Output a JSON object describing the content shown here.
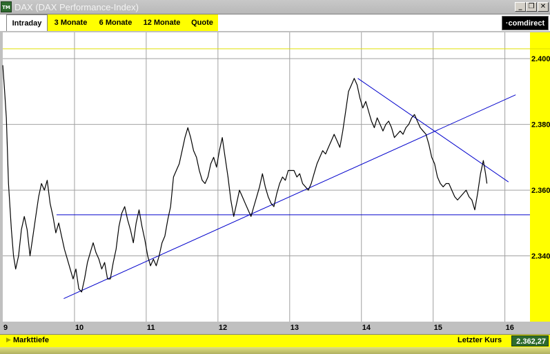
{
  "window": {
    "title": "DAX (DAX Performance-Index)",
    "icon_label": "TM",
    "controls": {
      "minimize": "_",
      "restore": "❐",
      "close": "✕"
    }
  },
  "tabs": [
    {
      "label": "Intraday",
      "active": true
    },
    {
      "label": "3 Monate",
      "active": false
    },
    {
      "label": "6 Monate",
      "active": false
    },
    {
      "label": "12 Monate",
      "active": false
    },
    {
      "label": "Quote",
      "active": false
    }
  ],
  "brand": "·comdirect",
  "colors": {
    "accent": "#ffff00",
    "price": "#000000",
    "trend": "#0000cc",
    "grid": "#a0a0a0",
    "value_bg": "#2e6b2e"
  },
  "status": {
    "left_label": "Markttiefe",
    "right_label": "Letzter Kurs",
    "value": "2.362,27"
  },
  "chart_data": {
    "type": "line",
    "title": "",
    "xlabel": "",
    "ylabel": "",
    "x_ticks": [
      "9",
      "10",
      "11",
      "12",
      "13",
      "14",
      "15",
      "16"
    ],
    "y_ticks": [
      "2.340",
      "2.360",
      "2.380",
      "2.400"
    ],
    "xlim": [
      9,
      16.35
    ],
    "ylim": [
      2320,
      2408
    ],
    "grid": true,
    "reference_line": {
      "y": 2403
    },
    "series": [
      {
        "values": [
          [
            9.0,
            2398
          ],
          [
            9.02,
            2392
          ],
          [
            9.05,
            2382
          ],
          [
            9.08,
            2362
          ],
          [
            9.12,
            2348
          ],
          [
            9.15,
            2340
          ],
          [
            9.18,
            2336
          ],
          [
            9.22,
            2340
          ],
          [
            9.26,
            2348
          ],
          [
            9.3,
            2352
          ],
          [
            9.34,
            2348
          ],
          [
            9.38,
            2340
          ],
          [
            9.42,
            2346
          ],
          [
            9.46,
            2352
          ],
          [
            9.5,
            2358
          ],
          [
            9.54,
            2362
          ],
          [
            9.58,
            2360
          ],
          [
            9.62,
            2363
          ],
          [
            9.66,
            2356
          ],
          [
            9.7,
            2352
          ],
          [
            9.74,
            2347
          ],
          [
            9.78,
            2350
          ],
          [
            9.82,
            2346
          ],
          [
            9.86,
            2342
          ],
          [
            9.9,
            2339
          ],
          [
            9.94,
            2336
          ],
          [
            9.98,
            2333
          ],
          [
            10.02,
            2336
          ],
          [
            10.06,
            2330
          ],
          [
            10.1,
            2329
          ],
          [
            10.14,
            2333
          ],
          [
            10.18,
            2338
          ],
          [
            10.22,
            2341
          ],
          [
            10.26,
            2344
          ],
          [
            10.3,
            2341
          ],
          [
            10.34,
            2339
          ],
          [
            10.38,
            2336
          ],
          [
            10.42,
            2338
          ],
          [
            10.46,
            2333
          ],
          [
            10.5,
            2333
          ],
          [
            10.54,
            2338
          ],
          [
            10.58,
            2342
          ],
          [
            10.62,
            2349
          ],
          [
            10.66,
            2353
          ],
          [
            10.7,
            2355
          ],
          [
            10.74,
            2351
          ],
          [
            10.78,
            2348
          ],
          [
            10.82,
            2344
          ],
          [
            10.86,
            2350
          ],
          [
            10.9,
            2354
          ],
          [
            10.94,
            2349
          ],
          [
            10.98,
            2345
          ],
          [
            11.02,
            2340
          ],
          [
            11.06,
            2337
          ],
          [
            11.1,
            2339
          ],
          [
            11.14,
            2337
          ],
          [
            11.18,
            2340
          ],
          [
            11.22,
            2344
          ],
          [
            11.26,
            2346
          ],
          [
            11.3,
            2351
          ],
          [
            11.34,
            2355
          ],
          [
            11.38,
            2364
          ],
          [
            11.42,
            2366
          ],
          [
            11.46,
            2368
          ],
          [
            11.5,
            2372
          ],
          [
            11.54,
            2376
          ],
          [
            11.58,
            2379
          ],
          [
            11.62,
            2376
          ],
          [
            11.66,
            2372
          ],
          [
            11.7,
            2370
          ],
          [
            11.74,
            2366
          ],
          [
            11.78,
            2363
          ],
          [
            11.82,
            2362
          ],
          [
            11.86,
            2364
          ],
          [
            11.9,
            2368
          ],
          [
            11.94,
            2370
          ],
          [
            11.98,
            2367
          ],
          [
            12.02,
            2372
          ],
          [
            12.06,
            2376
          ],
          [
            12.1,
            2370
          ],
          [
            12.14,
            2364
          ],
          [
            12.18,
            2357
          ],
          [
            12.22,
            2352
          ],
          [
            12.26,
            2356
          ],
          [
            12.3,
            2360
          ],
          [
            12.34,
            2358
          ],
          [
            12.38,
            2356
          ],
          [
            12.42,
            2354
          ],
          [
            12.46,
            2352
          ],
          [
            12.5,
            2355
          ],
          [
            12.54,
            2358
          ],
          [
            12.58,
            2361
          ],
          [
            12.62,
            2365
          ],
          [
            12.66,
            2361
          ],
          [
            12.7,
            2358
          ],
          [
            12.74,
            2356
          ],
          [
            12.78,
            2355
          ],
          [
            12.82,
            2359
          ],
          [
            12.86,
            2362
          ],
          [
            12.9,
            2364
          ],
          [
            12.94,
            2363
          ],
          [
            12.98,
            2366
          ],
          [
            13.02,
            2366
          ],
          [
            13.06,
            2366
          ],
          [
            13.1,
            2364
          ],
          [
            13.14,
            2365
          ],
          [
            13.18,
            2362
          ],
          [
            13.22,
            2361
          ],
          [
            13.26,
            2360
          ],
          [
            13.3,
            2362
          ],
          [
            13.34,
            2365
          ],
          [
            13.38,
            2368
          ],
          [
            13.42,
            2370
          ],
          [
            13.46,
            2372
          ],
          [
            13.5,
            2371
          ],
          [
            13.54,
            2373
          ],
          [
            13.58,
            2375
          ],
          [
            13.62,
            2377
          ],
          [
            13.66,
            2375
          ],
          [
            13.7,
            2373
          ],
          [
            13.74,
            2378
          ],
          [
            13.78,
            2384
          ],
          [
            13.82,
            2390
          ],
          [
            13.86,
            2392
          ],
          [
            13.9,
            2394
          ],
          [
            13.94,
            2392
          ],
          [
            13.98,
            2388
          ],
          [
            14.02,
            2385
          ],
          [
            14.06,
            2387
          ],
          [
            14.1,
            2384
          ],
          [
            14.14,
            2381
          ],
          [
            14.18,
            2379
          ],
          [
            14.22,
            2382
          ],
          [
            14.26,
            2380
          ],
          [
            14.3,
            2378
          ],
          [
            14.34,
            2380
          ],
          [
            14.38,
            2381
          ],
          [
            14.42,
            2379
          ],
          [
            14.46,
            2376
          ],
          [
            14.5,
            2377
          ],
          [
            14.54,
            2378
          ],
          [
            14.58,
            2377
          ],
          [
            14.62,
            2379
          ],
          [
            14.66,
            2380
          ],
          [
            14.7,
            2382
          ],
          [
            14.74,
            2383
          ],
          [
            14.78,
            2381
          ],
          [
            14.82,
            2379
          ],
          [
            14.86,
            2378
          ],
          [
            14.9,
            2377
          ],
          [
            14.94,
            2374
          ],
          [
            14.98,
            2370
          ],
          [
            15.02,
            2368
          ],
          [
            15.06,
            2364
          ],
          [
            15.1,
            2362
          ],
          [
            15.14,
            2361
          ],
          [
            15.18,
            2362
          ],
          [
            15.22,
            2362
          ],
          [
            15.26,
            2360
          ],
          [
            15.3,
            2358
          ],
          [
            15.34,
            2357
          ],
          [
            15.38,
            2358
          ],
          [
            15.42,
            2359
          ],
          [
            15.46,
            2360
          ],
          [
            15.5,
            2358
          ],
          [
            15.54,
            2357
          ],
          [
            15.58,
            2354
          ],
          [
            15.62,
            2359
          ],
          [
            15.66,
            2365
          ],
          [
            15.7,
            2369
          ],
          [
            15.73,
            2365
          ],
          [
            15.75,
            2362
          ]
        ]
      }
    ],
    "trendlines": [
      {
        "from": [
          9.75,
          2352.5
        ],
        "to": [
          16.35,
          2352.5
        ]
      },
      {
        "from": [
          9.85,
          2327
        ],
        "to": [
          16.15,
          2389
        ]
      },
      {
        "from": [
          13.95,
          2394
        ],
        "to": [
          16.05,
          2362.5
        ]
      }
    ]
  }
}
